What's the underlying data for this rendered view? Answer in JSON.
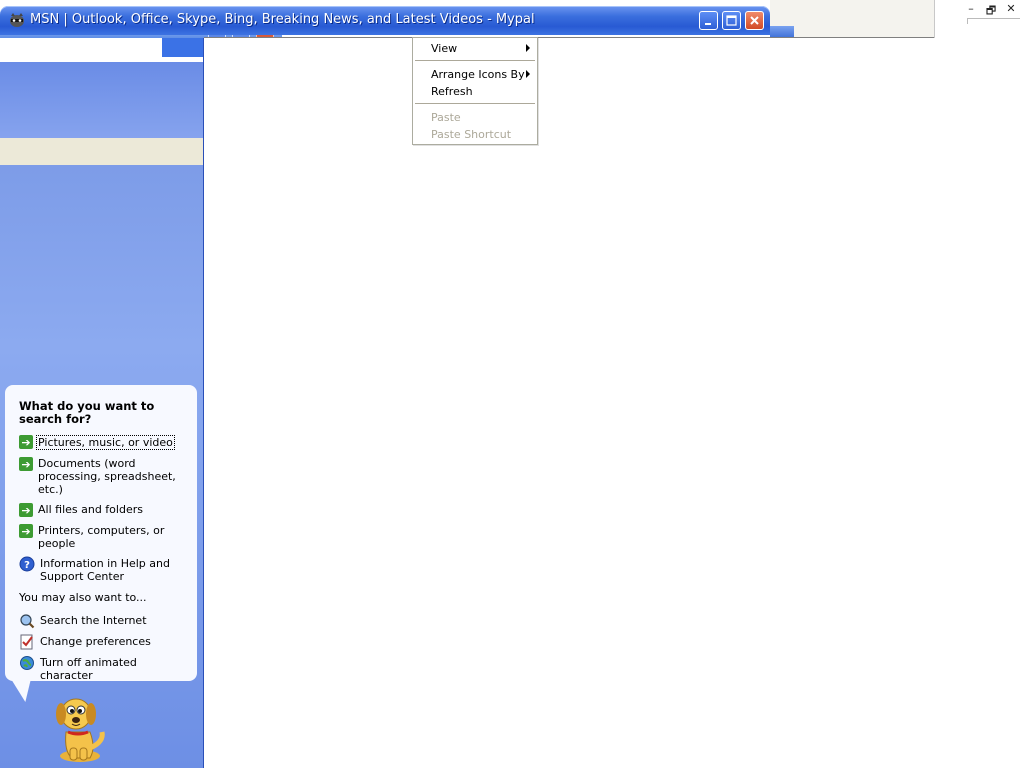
{
  "window": {
    "title": "MSN | Outlook, Office, Skype, Bing, Breaking News, and Latest Videos - Mypal",
    "controls": {
      "minimize": "minimize",
      "maximize": "maximize",
      "close": "close"
    }
  },
  "outer_controls": {
    "minimize": "–",
    "restore": "🗗",
    "close": "✕"
  },
  "search_companion": {
    "heading": "What do you want to search for?",
    "options": [
      {
        "label": "Pictures, music, or video",
        "icon": "green-arrow-icon"
      },
      {
        "label": "Documents (word processing, spreadsheet, etc.)",
        "icon": "green-arrow-icon"
      },
      {
        "label": "All files and folders",
        "icon": "green-arrow-icon"
      },
      {
        "label": "Printers, computers, or people",
        "icon": "green-arrow-icon"
      },
      {
        "label": "Information in Help and Support Center",
        "icon": "help-icon"
      }
    ],
    "also_label": "You may also want to...",
    "also_options": [
      {
        "label": "Search the Internet",
        "icon": "search-internet-icon"
      },
      {
        "label": "Change preferences",
        "icon": "preferences-icon"
      },
      {
        "label": "Turn off animated character",
        "icon": "globe-icon"
      }
    ],
    "character": "dog-character"
  },
  "context_menu": {
    "items": [
      {
        "label": "View",
        "submenu": true,
        "enabled": true
      },
      {
        "label": "Arrange Icons By",
        "submenu": true,
        "enabled": true
      },
      {
        "label": "Refresh",
        "submenu": false,
        "enabled": true
      },
      {
        "label": "Paste",
        "submenu": false,
        "enabled": false
      },
      {
        "label": "Paste Shortcut",
        "submenu": false,
        "enabled": false
      }
    ]
  },
  "colors": {
    "title_bar": "#285ad3",
    "pane_blue": "#7b9ae9",
    "balloon_bg": "#f7f9ff",
    "close_button": "#d24a26",
    "disabled_text": "#aca899"
  }
}
